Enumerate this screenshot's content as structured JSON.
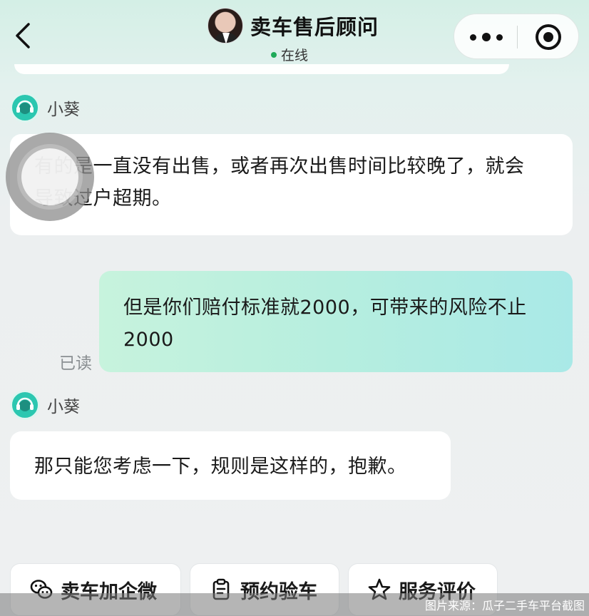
{
  "header": {
    "title": "卖车售后顾问",
    "status": "在线"
  },
  "messages": [
    {
      "sender": "小葵",
      "side": "left",
      "text": "有的是一直没有出售，或者再次出售时间比较晚了，就会导致过户超期。"
    },
    {
      "sender": "me",
      "side": "right",
      "text": "但是你们赔付标准就2000，可带来的风险不止2000",
      "read_status": "已读"
    },
    {
      "sender": "小葵",
      "side": "left",
      "text": "那只能您考虑一下，规则是这样的，抱歉。"
    }
  ],
  "quick_actions": [
    {
      "label": "卖车加企微",
      "icon": "wechat-icon"
    },
    {
      "label": "预约验车",
      "icon": "clipboard-icon"
    },
    {
      "label": "服务评价",
      "icon": "star-icon"
    }
  ],
  "watermark": "图片来源：瓜子二手车平台截图",
  "colors": {
    "online_dot": "#1faa59",
    "agent_avatar": "#2bc7b0",
    "my_bubble_start": "#c7f3dd",
    "my_bubble_end": "#a9e9e7"
  }
}
